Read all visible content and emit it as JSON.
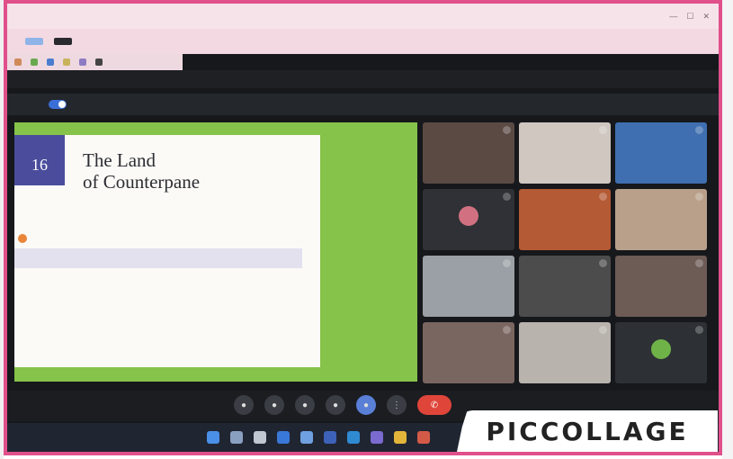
{
  "slide": {
    "number": "16",
    "title_line1": "The Land",
    "title_line2": "of Counterpane"
  },
  "watermark": {
    "text": "PICCOLLAGE"
  },
  "participants": [
    {
      "label": "",
      "bg": "#5b4a44",
      "avatar": ""
    },
    {
      "label": "",
      "bg": "#cfc7c0",
      "avatar": ""
    },
    {
      "label": "",
      "bg": "#3f6fb0",
      "avatar": ""
    },
    {
      "label": "",
      "bg": "#2f3136",
      "avatar": "#d07080"
    },
    {
      "label": "",
      "bg": "#b45a35",
      "avatar": ""
    },
    {
      "label": "",
      "bg": "#b8a08a",
      "avatar": ""
    },
    {
      "label": "",
      "bg": "#9aa0a5",
      "avatar": ""
    },
    {
      "label": "",
      "bg": "#4c4c4c",
      "avatar": ""
    },
    {
      "label": "",
      "bg": "#6d5b55",
      "avatar": ""
    },
    {
      "label": "",
      "bg": "#7a6660",
      "avatar": ""
    },
    {
      "label": "",
      "bg": "#b9b3ad",
      "avatar": ""
    },
    {
      "label": "",
      "bg": "#2d3035",
      "avatar": "#6fb348"
    }
  ],
  "colors": {
    "frame": "#e0508a",
    "slide_bg": "#86c34a",
    "end_call": "#e0453a",
    "toggle": "#3b6fd6"
  },
  "icons": [
    "mic-icon",
    "camera-icon",
    "captions-icon",
    "raise-hand-icon",
    "present-icon",
    "more-icon",
    "end-call-icon"
  ]
}
